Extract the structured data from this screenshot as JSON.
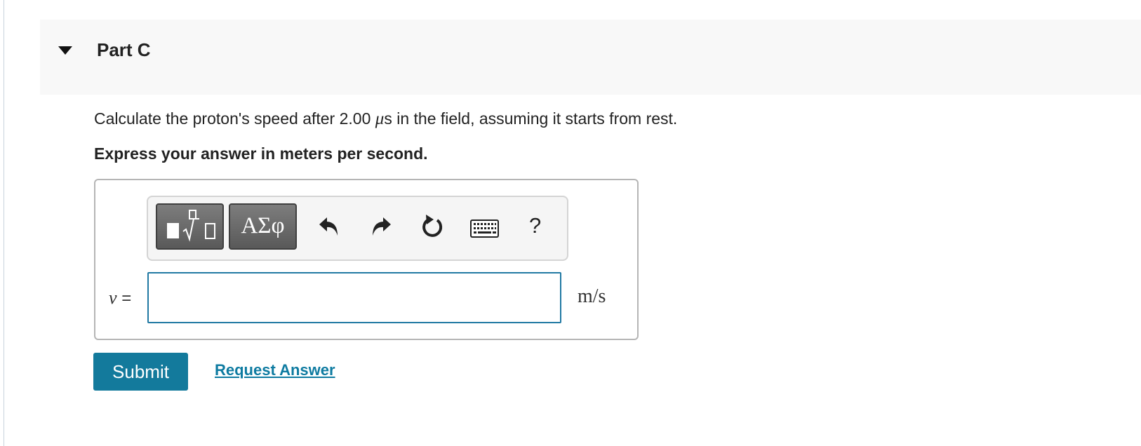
{
  "part": {
    "title": "Part C"
  },
  "question": {
    "text_before": "Calculate the proton's speed after 2.00 ",
    "unit_symbol": "μ",
    "text_after": "s in the field, assuming it starts from rest."
  },
  "instruction": "Express your answer in meters per second.",
  "toolbar": {
    "greek_label": "ΑΣφ",
    "help_label": "?",
    "icons": [
      "templates-icon",
      "undo-icon",
      "redo-icon",
      "reset-icon",
      "keyboard-icon",
      "help-icon"
    ]
  },
  "answer": {
    "variable": "v",
    "equals": " =",
    "value": "",
    "units": "m/s"
  },
  "actions": {
    "submit_label": "Submit",
    "request_label": "Request Answer"
  },
  "colors": {
    "accent": "#137a9c",
    "link": "#0e7ba1",
    "input_border": "#2179a3",
    "header_bg": "#f8f8f8"
  }
}
